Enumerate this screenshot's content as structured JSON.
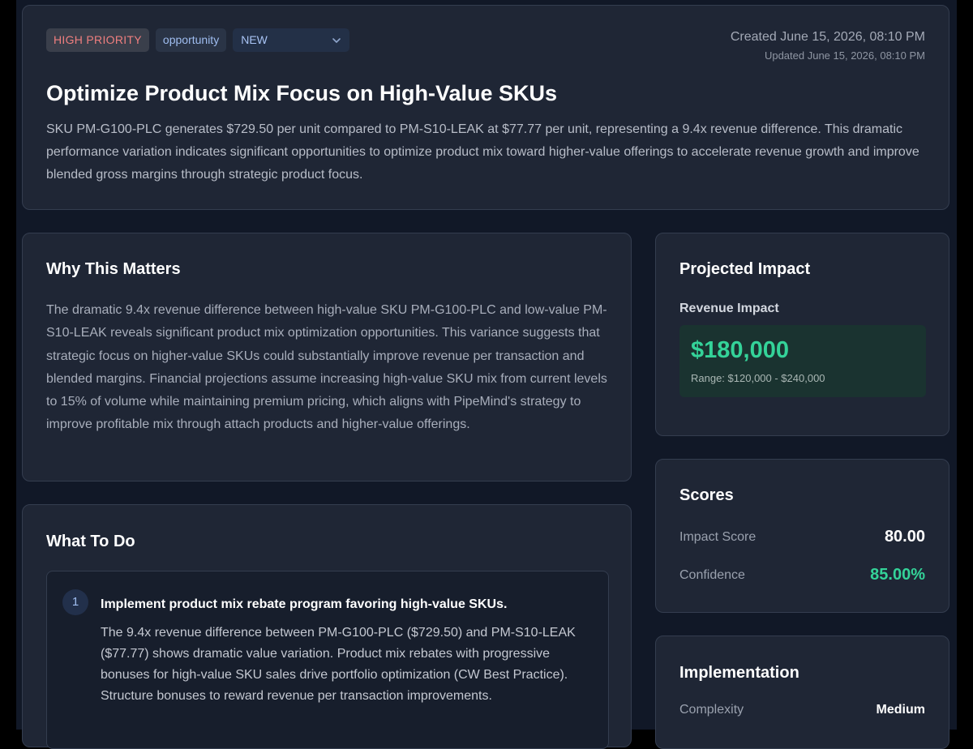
{
  "header": {
    "priority_badge": "HIGH PRIORITY",
    "type_badge": "opportunity",
    "status": {
      "selected": "NEW"
    },
    "created": "Created June 15, 2026, 08:10 PM",
    "updated": "Updated June 15, 2026, 08:10 PM",
    "title": "Optimize Product Mix Focus on High-Value SKUs",
    "summary": "SKU PM-G100-PLC generates $729.50 per unit compared to PM-S10-LEAK at $77.77 per unit, representing a 9.4x revenue difference. This dramatic performance variation indicates significant opportunities to optimize product mix toward higher-value offerings to accelerate revenue growth and improve blended gross margins through strategic product focus."
  },
  "why": {
    "title": "Why This Matters",
    "text": "The dramatic 9.4x revenue difference between high-value SKU PM-G100-PLC and low-value PM-S10-LEAK reveals significant product mix optimization opportunities. This variance suggests that strategic focus on higher-value SKUs could substantially improve revenue per transaction and blended margins. Financial projections assume increasing high-value SKU mix from current levels to 15% of volume while maintaining premium pricing, which aligns with PipeMind's strategy to improve profitable mix through attach products and higher-value offerings."
  },
  "todo": {
    "title": "What To Do",
    "steps": [
      {
        "number": "1",
        "title": "Implement product mix rebate program favoring high-value SKUs.",
        "body": "The 9.4x revenue difference between PM-G100-PLC ($729.50) and PM-S10-LEAK ($77.77) shows dramatic value variation. Product mix rebates with progressive bonuses for high-value SKU sales drive portfolio optimization (CW Best Practice). Structure bonuses to reward revenue per transaction improvements."
      }
    ]
  },
  "impact": {
    "title": "Projected Impact",
    "label": "Revenue Impact",
    "value": "$180,000",
    "range": "Range: $120,000 - $240,000"
  },
  "scores": {
    "title": "Scores",
    "impact_label": "Impact Score",
    "impact_value": "80.00",
    "confidence_label": "Confidence",
    "confidence_value": "85.00%"
  },
  "implementation": {
    "title": "Implementation",
    "complexity_label": "Complexity",
    "complexity_value": "Medium"
  },
  "colors": {
    "accent_green": "#34d399",
    "priority_red": "#f07f7f",
    "badge_blue": "#9fbdf0"
  },
  "icons": {
    "status_dropdown": "chevron-down-icon"
  }
}
